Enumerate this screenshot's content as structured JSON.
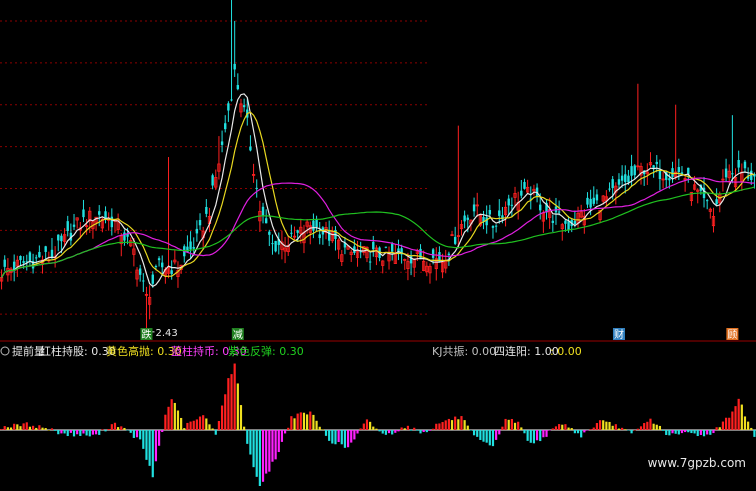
{
  "colors": {
    "background": "#000000",
    "grid": "#8b0000",
    "candle_up": "#ff2020",
    "candle_down": "#20e0e0",
    "ma_white": "#e8e8e8",
    "ma_yellow": "#e8d820",
    "ma_magenta": "#e020e0",
    "ma_green": "#20c020",
    "bar_red": "#ff2020",
    "bar_yellow": "#f0e020",
    "bar_cyan": "#20e0e0",
    "bar_magenta": "#ff20ff"
  },
  "legend": {
    "title": "提前量",
    "items": [
      {
        "label": "红柱持股:",
        "value": "0.30",
        "color": "#e8e8e8"
      },
      {
        "label": "黄色高抛:",
        "value": "0.30",
        "color": "#f0e020"
      },
      {
        "label": "蓝柱持币:",
        "value": "0.30",
        "color": "#ff40ff"
      },
      {
        "label": "紫色反弹:",
        "value": "0.30",
        "color": "#20d020"
      },
      {
        "label": "KJ共振:",
        "value": "0.00",
        "color": "#c0c0c0"
      },
      {
        "label": "四连阳:",
        "value": "1.00",
        "color": "#e8e8e8"
      },
      {
        "label": ":",
        "value": "0.00",
        "color": "#f0e020"
      }
    ]
  },
  "watermark": "www.7gpzb.com",
  "signals": [
    {
      "text": "跌",
      "index": 46,
      "bg": "#208020",
      "fg": "#ffffff"
    },
    {
      "text": "减",
      "index": 75,
      "bg": "#208020",
      "fg": "#ffffff"
    },
    {
      "text": "财",
      "index": 196,
      "bg": "#3080c0",
      "fg": "#ffffff"
    },
    {
      "text": "顾",
      "index": 232,
      "bg": "#e07020",
      "fg": "#ffffff"
    }
  ],
  "chart_data": [
    {
      "type": "candlestick",
      "annotations": [
        {
          "text": "2.43",
          "index": 46,
          "at": "low"
        }
      ],
      "anchors": [
        [
          0,
          3.0
        ],
        [
          8,
          3.1
        ],
        [
          16,
          3.15
        ],
        [
          24,
          3.45
        ],
        [
          30,
          3.55
        ],
        [
          36,
          3.48
        ],
        [
          42,
          3.2
        ],
        [
          46,
          2.75
        ],
        [
          50,
          3.05
        ],
        [
          56,
          3.05
        ],
        [
          62,
          3.3
        ],
        [
          66,
          3.6
        ],
        [
          70,
          4.2
        ],
        [
          74,
          4.9
        ],
        [
          78,
          4.4
        ],
        [
          82,
          3.6
        ],
        [
          86,
          3.25
        ],
        [
          92,
          3.3
        ],
        [
          98,
          3.45
        ],
        [
          104,
          3.35
        ],
        [
          110,
          3.18
        ],
        [
          130,
          3.15
        ],
        [
          140,
          3.12
        ],
        [
          146,
          3.45
        ],
        [
          150,
          3.6
        ],
        [
          156,
          3.45
        ],
        [
          162,
          3.7
        ],
        [
          168,
          3.75
        ],
        [
          174,
          3.55
        ],
        [
          180,
          3.45
        ],
        [
          186,
          3.6
        ],
        [
          192,
          3.7
        ],
        [
          198,
          3.85
        ],
        [
          204,
          4.0
        ],
        [
          210,
          3.95
        ],
        [
          216,
          3.95
        ],
        [
          222,
          3.7
        ],
        [
          226,
          3.55
        ],
        [
          230,
          3.95
        ],
        [
          236,
          3.95
        ],
        [
          239,
          3.9
        ]
      ]
    },
    {
      "type": "bar",
      "anchors": [
        [
          0,
          0.4
        ],
        [
          8,
          0.8
        ],
        [
          14,
          0.3
        ],
        [
          20,
          -0.6
        ],
        [
          30,
          -0.8
        ],
        [
          36,
          1.0
        ],
        [
          44,
          -1.5
        ],
        [
          48,
          -6.5
        ],
        [
          52,
          2.0
        ],
        [
          54,
          4.5
        ],
        [
          58,
          0.5
        ],
        [
          64,
          2.0
        ],
        [
          68,
          -0.4
        ],
        [
          72,
          7.0
        ],
        [
          74,
          9.0
        ],
        [
          78,
          -2.0
        ],
        [
          82,
          -8.0
        ],
        [
          88,
          -3.0
        ],
        [
          92,
          1.8
        ],
        [
          98,
          2.5
        ],
        [
          104,
          -1.4
        ],
        [
          110,
          -2.5
        ],
        [
          116,
          1.3
        ],
        [
          122,
          -0.8
        ],
        [
          128,
          0.5
        ],
        [
          134,
          -0.4
        ],
        [
          140,
          1.2
        ],
        [
          146,
          1.8
        ],
        [
          150,
          -1.0
        ],
        [
          156,
          -2.5
        ],
        [
          160,
          1.6
        ],
        [
          164,
          1.0
        ],
        [
          168,
          -2.0
        ],
        [
          172,
          -1.0
        ],
        [
          178,
          1.0
        ],
        [
          184,
          -0.8
        ],
        [
          190,
          1.2
        ],
        [
          196,
          0.5
        ],
        [
          200,
          -0.6
        ],
        [
          206,
          1.5
        ],
        [
          212,
          -0.8
        ],
        [
          218,
          -0.4
        ],
        [
          224,
          -0.8
        ],
        [
          228,
          0.5
        ],
        [
          232,
          2.5
        ],
        [
          234,
          4.5
        ],
        [
          236,
          2.0
        ],
        [
          239,
          -0.8
        ]
      ]
    }
  ]
}
